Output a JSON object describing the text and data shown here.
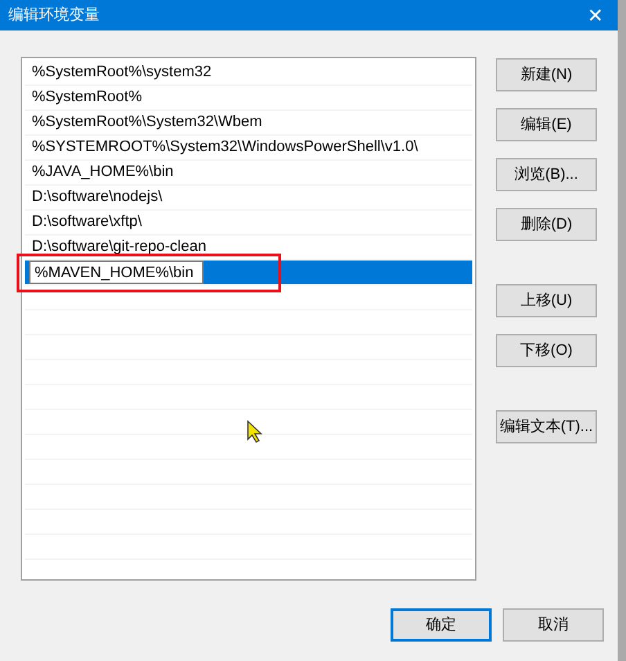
{
  "window": {
    "title": "编辑环境变量",
    "close": "✕"
  },
  "paths": [
    {
      "text": "%SystemRoot%\\system32",
      "selected": false,
      "editing": false
    },
    {
      "text": "%SystemRoot%",
      "selected": false,
      "editing": false
    },
    {
      "text": "%SystemRoot%\\System32\\Wbem",
      "selected": false,
      "editing": false
    },
    {
      "text": "%SYSTEMROOT%\\System32\\WindowsPowerShell\\v1.0\\",
      "selected": false,
      "editing": false
    },
    {
      "text": "%JAVA_HOME%\\bin",
      "selected": false,
      "editing": false
    },
    {
      "text": "D:\\software\\nodejs\\",
      "selected": false,
      "editing": false
    },
    {
      "text": "D:\\software\\xftp\\",
      "selected": false,
      "editing": false
    },
    {
      "text": "D:\\software\\git-repo-clean",
      "selected": false,
      "editing": false
    },
    {
      "text": "%MAVEN_HOME%\\bin",
      "selected": true,
      "editing": true
    }
  ],
  "side_button_groups": [
    [
      "新建(N)",
      "编辑(E)",
      "浏览(B)...",
      "删除(D)"
    ],
    [
      "上移(U)",
      "下移(O)"
    ],
    [
      "编辑文本(T)..."
    ]
  ],
  "footer_buttons": [
    {
      "label": "确定",
      "default": true
    },
    {
      "label": "取消",
      "default": false
    }
  ]
}
